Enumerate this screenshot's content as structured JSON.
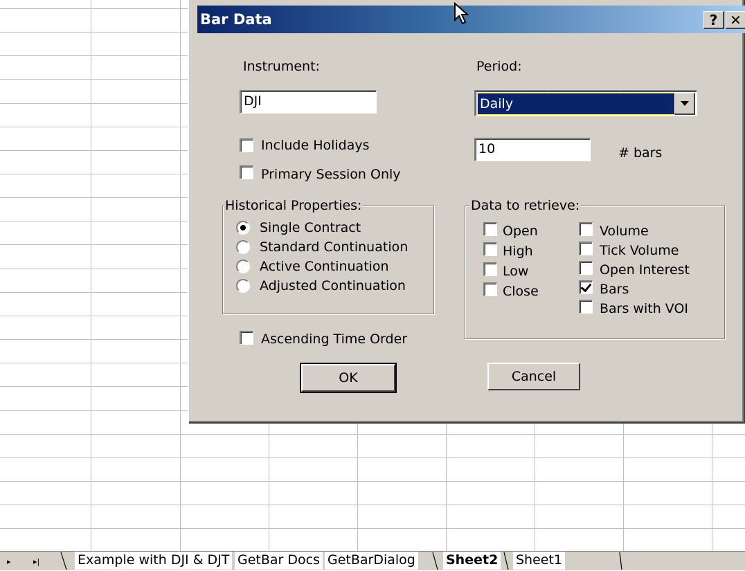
{
  "dialog": {
    "title": "Bar Data",
    "help_button": "?",
    "close_button": "✕",
    "instrument_label": "Instrument:",
    "instrument_value": "DJI",
    "period_label": "Period:",
    "period_value": "Daily",
    "include_holidays_label": "Include Holidays",
    "include_holidays_checked": false,
    "primary_session_label": "Primary Session Only",
    "primary_session_checked": false,
    "bars_count_value": "10",
    "bars_count_label": "# bars",
    "historical_title": "Historical Properties:",
    "historical_options": [
      {
        "label": "Single Contract",
        "selected": true
      },
      {
        "label": "Standard Continuation",
        "selected": false
      },
      {
        "label": "Active Continuation",
        "selected": false
      },
      {
        "label": "Adjusted Continuation",
        "selected": false
      }
    ],
    "data_title": "Data to retrieve:",
    "data_left": [
      {
        "label": "Open",
        "checked": false
      },
      {
        "label": "High",
        "checked": false
      },
      {
        "label": "Low",
        "checked": false
      },
      {
        "label": "Close",
        "checked": false
      }
    ],
    "data_right": [
      {
        "label": "Volume",
        "checked": false
      },
      {
        "label": "Tick Volume",
        "checked": false
      },
      {
        "label": "Open Interest",
        "checked": false
      },
      {
        "label": "Bars",
        "checked": true
      },
      {
        "label": "Bars with VOI",
        "checked": false
      }
    ],
    "ascending_label": "Ascending Time Order",
    "ascending_checked": false,
    "ok_label": "OK",
    "cancel_label": "Cancel"
  },
  "sheet_tabs": {
    "nav_next": "▸",
    "nav_last": "▸|",
    "tabs": [
      {
        "label": "Example with DJI & DJT",
        "active": false
      },
      {
        "label": "GetBar Docs",
        "active": false
      },
      {
        "label": "GetBarDialog",
        "active": false
      },
      {
        "label": "Sheet2",
        "active": true
      },
      {
        "label": "Sheet1",
        "active": false
      }
    ]
  },
  "colors": {
    "dialog_face": "#d4d0c8",
    "title_start": "#0a246a",
    "title_end": "#a6caf0",
    "selection": "#0a246a",
    "grid_line": "#c0c0c0"
  }
}
